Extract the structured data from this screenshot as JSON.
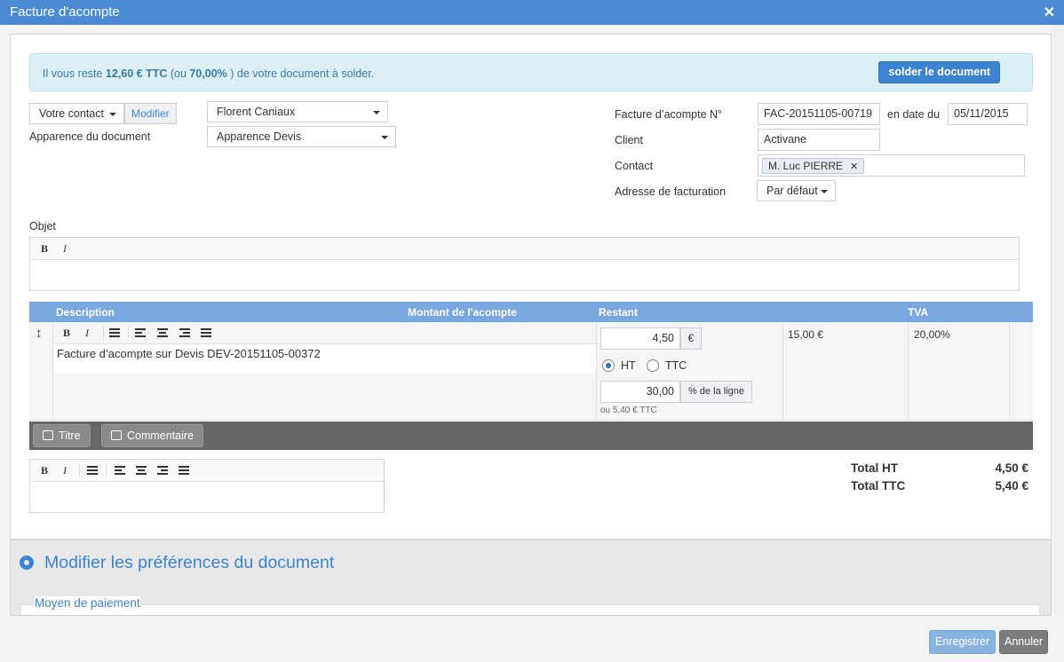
{
  "window": {
    "title": "Facture d'acompte"
  },
  "alert": {
    "prefix": "Il vous reste ",
    "amount": "12,60 € TTC",
    "mid": " (ou ",
    "percent": "70,00%",
    "suffix": " ) de votre document à solder.",
    "button": "solder le document"
  },
  "left_form": {
    "contact_select": "Votre contact",
    "modify_button": "Modifier",
    "contact_value": "Florent Caniaux",
    "appearance_label": "Apparence du document",
    "appearance_value": "Apparence Devis"
  },
  "right_form": {
    "invoice_label": "Facture d’acompte N°",
    "invoice_number": "FAC-20151105-00719",
    "date_label": "en date du",
    "date_value": "05/11/2015",
    "client_label": "Client",
    "client_value": "Activane",
    "contact_label": "Contact",
    "contact_tag": "M. Luc PIERRE",
    "billing_label": "Adresse de facturation",
    "billing_value": "Par défaut"
  },
  "object": {
    "label": "Objet"
  },
  "toolbar": {
    "bold": "B",
    "italic": "I"
  },
  "table": {
    "headers": [
      "Description",
      "Montant de l'acompte",
      "Restant",
      "TVA"
    ],
    "row": {
      "description": "Facture d’acompte sur Devis DEV-20151105-00372",
      "amount": "4,50",
      "currency": "€",
      "radio_ht": "HT",
      "radio_ttc": "TTC",
      "percent": "30,00",
      "percent_unit": "% de la ligne",
      "ttc_note": "ou 5,40 € TTC",
      "remaining": "15,00 €",
      "vat": "20,00%"
    }
  },
  "actions": {
    "title_button": "Titre",
    "comment_button": "Commentaire"
  },
  "totals": {
    "ht_label": "Total HT",
    "ht_value": "4,50 €",
    "ttc_label": "Total TTC",
    "ttc_value": "5,40 €"
  },
  "preferences": {
    "title": "Modifier les préférences du document",
    "payment_legend": "Moyen de paiement"
  },
  "footer": {
    "save": "Enregistrer",
    "cancel": "Annuler"
  },
  "icons": [
    "close-icon",
    "caret-down-icon",
    "bold-icon",
    "italic-icon",
    "list-icon",
    "align-left-icon",
    "align-center-icon",
    "align-right-icon",
    "justify-icon",
    "move-icon",
    "edit-icon",
    "gear-icon",
    "remove-tag-icon"
  ]
}
